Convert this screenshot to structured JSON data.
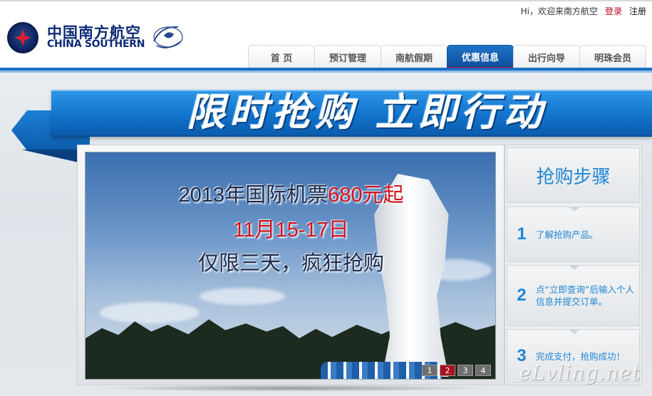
{
  "header": {
    "greeting": "Hi，欢迎来南方航空",
    "login": "登录",
    "register": "注册",
    "logo_cn": "中国南方航空",
    "logo_en": "CHINA SOUTHERN"
  },
  "nav": {
    "tabs": [
      {
        "label": "首 页"
      },
      {
        "label": "预订管理"
      },
      {
        "label": "南航假期"
      },
      {
        "label": "优惠信息",
        "active": true
      },
      {
        "label": "出行向导"
      },
      {
        "label": "明珠会员"
      }
    ]
  },
  "promo": {
    "title": "限时抢购 立即行动",
    "banner": {
      "line1_prefix": "2013年国际机票",
      "line1_price": "680元起",
      "line2": "11月15-17日",
      "line3": "仅限三天，疯狂抢购"
    },
    "slides": [
      "1",
      "2",
      "3",
      "4"
    ],
    "active_slide": "2"
  },
  "steps": {
    "title": "抢购步骤",
    "items": [
      {
        "num": "1",
        "text": "了解抢购产品。"
      },
      {
        "num": "2",
        "text": "点“立即查询”后输入个人信息并提交订单。"
      },
      {
        "num": "3",
        "text": "完成支付，抢购成功！"
      }
    ]
  },
  "watermark": "eLvling.net",
  "colors": {
    "brand_blue": "#1a6fc2",
    "accent_red": "#c8001e",
    "step_blue": "#1f86d6"
  }
}
